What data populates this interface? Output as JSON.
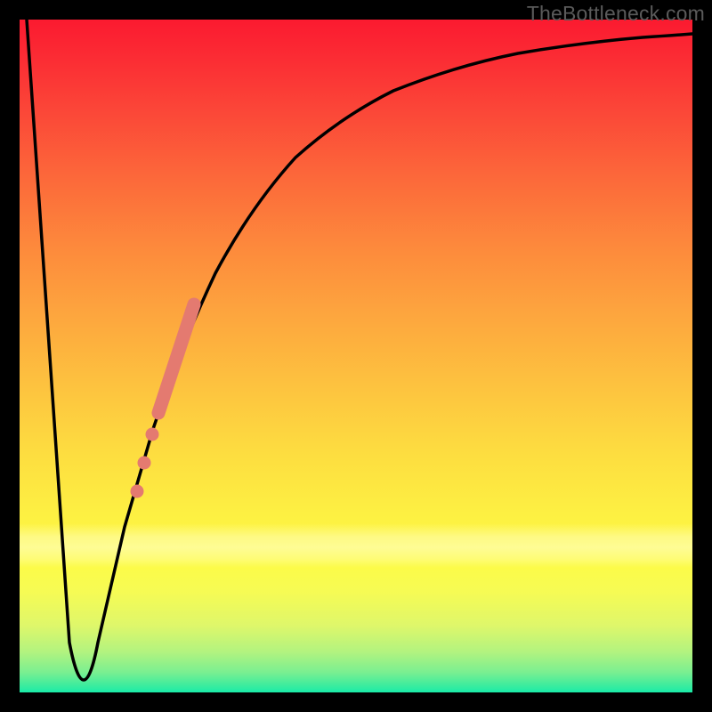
{
  "watermark": "TheBottleneck.com",
  "colors": {
    "background": "#000000",
    "curve_stroke": "#000000",
    "marker_fill": "#e47a70",
    "gradient_top": "#fb1a30",
    "gradient_bottom": "#1aeba9"
  },
  "chart_data": {
    "type": "line",
    "title": "",
    "xlabel": "",
    "ylabel": "",
    "xlim": [
      0,
      100
    ],
    "ylim": [
      0,
      100
    ],
    "note": "Axes unlabeled in source image; values below are pixel-estimated on a 0–100 scale where y=100 is top and y=0 is bottom.",
    "series": [
      {
        "name": "curve",
        "x": [
          0,
          2,
          4,
          6,
          8,
          9,
          10,
          11,
          12,
          14,
          16,
          18,
          20,
          22,
          25,
          28,
          32,
          36,
          40,
          45,
          50,
          55,
          60,
          66,
          72,
          78,
          85,
          92,
          100
        ],
        "y": [
          100,
          78,
          55,
          32,
          12,
          4,
          2,
          2,
          4,
          12,
          24,
          35,
          44,
          52,
          60,
          67,
          73,
          78,
          82,
          85,
          88,
          90,
          91.5,
          93,
          94,
          95,
          95.8,
          96.5,
          97
        ]
      }
    ],
    "markers": {
      "name": "highlighted-segment",
      "color": "#e47a70",
      "points": [
        {
          "x": 17.0,
          "y": 29,
          "type": "dot"
        },
        {
          "x": 18.0,
          "y": 33,
          "type": "dot"
        },
        {
          "x": 19.0,
          "y": 37,
          "type": "dot"
        },
        {
          "x": 20.0,
          "y": 41,
          "type": "segment_start"
        },
        {
          "x": 25.0,
          "y": 58,
          "type": "segment_end"
        }
      ]
    }
  }
}
